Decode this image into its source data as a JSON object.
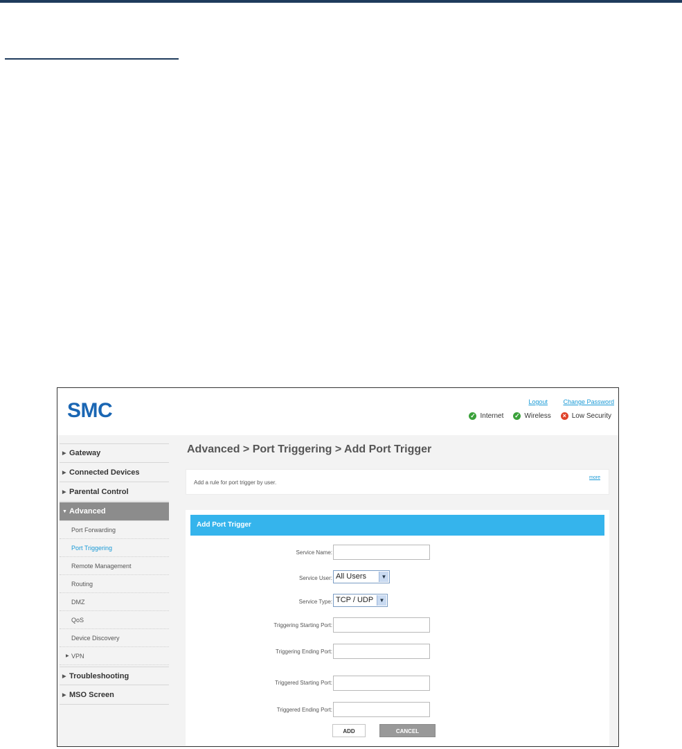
{
  "header": {
    "logo": "SMC",
    "links": {
      "logout": "Logout",
      "change_password": "Change Password"
    },
    "status": {
      "internet": "Internet",
      "wireless": "Wireless",
      "security": "Low Security"
    }
  },
  "sidebar": {
    "items": [
      {
        "label": "Gateway"
      },
      {
        "label": "Connected Devices"
      },
      {
        "label": "Parental Control"
      },
      {
        "label": "Advanced"
      },
      {
        "label": "Troubleshooting"
      },
      {
        "label": "MSO Screen"
      }
    ],
    "advanced_subitems": [
      {
        "label": "Port Forwarding"
      },
      {
        "label": "Port Triggering"
      },
      {
        "label": "Remote Management"
      },
      {
        "label": "Routing"
      },
      {
        "label": "DMZ"
      },
      {
        "label": "QoS"
      },
      {
        "label": "Device Discovery"
      },
      {
        "label": "VPN"
      }
    ]
  },
  "main": {
    "title": "Advanced > Port Triggering > Add Port Trigger",
    "info_text": "Add a rule for port trigger by user.",
    "more_link": "more"
  },
  "form": {
    "header": "Add Port Trigger",
    "service_name": {
      "label": "Service Name:",
      "value": ""
    },
    "service_user": {
      "label": "Service User:",
      "value": "All Users"
    },
    "service_type": {
      "label": "Service Type:",
      "value": "TCP / UDP"
    },
    "triggering_start": {
      "label": "Triggering Starting Port:",
      "value": ""
    },
    "triggering_end": {
      "label": "Triggering Ending Port:",
      "value": ""
    },
    "triggered_start": {
      "label": "Triggered Starting Port:",
      "value": ""
    },
    "triggered_end": {
      "label": "Triggered Ending Port:",
      "value": ""
    },
    "add_label": "ADD",
    "cancel_label": "CANCEL"
  },
  "colors": {
    "accent": "#35b4ec",
    "brand": "#1a66b3",
    "active_nav": "#8c8c8c"
  }
}
